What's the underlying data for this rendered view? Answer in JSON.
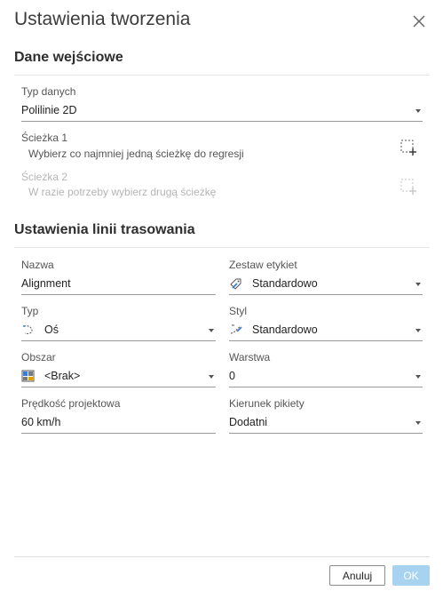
{
  "dialog": {
    "title": "Ustawienia tworzenia",
    "input_section": {
      "title": "Dane wejściowe",
      "data_type_label": "Typ danych",
      "data_type_value": "Polilinie 2D",
      "path1_label": "Ścieżka 1",
      "path1_hint": "Wybierz co najmniej jedną ścieżkę do regresji",
      "path2_label": "Ścieżka 2",
      "path2_hint": "W razie potrzeby wybierz drugą ścieżkę"
    },
    "alignment_section": {
      "title": "Ustawienia linii trasowania",
      "name_label": "Nazwa",
      "name_value": "Alignment",
      "label_set_label": "Zestaw etykiet",
      "label_set_value": "Standardowo",
      "type_label": "Typ",
      "type_value": "Oś",
      "style_label": "Styl",
      "style_value": "Standardowo",
      "site_label": "Obszar",
      "site_value": "<Brak>",
      "layer_label": "Warstwa",
      "layer_value": "0",
      "design_speed_label": "Prędkość projektowa",
      "design_speed_value": "60 km/h",
      "station_dir_label": "Kierunek pikiety",
      "station_dir_value": "Dodatni"
    },
    "buttons": {
      "cancel": "Anuluj",
      "ok": "OK"
    }
  },
  "colors": {
    "ok_button": "#a8d3f0",
    "label_icon_accent": "#3a7bd5"
  }
}
